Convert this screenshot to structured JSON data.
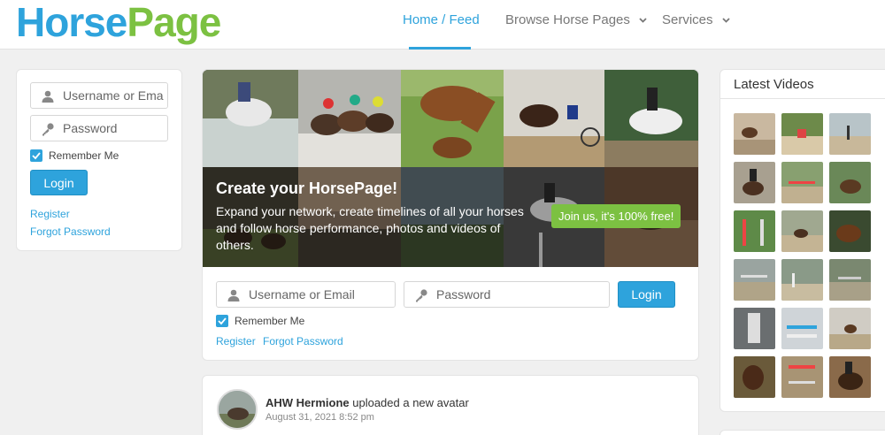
{
  "brand": {
    "part1": "Horse",
    "part2": "Page"
  },
  "nav": {
    "home": "Home / Feed",
    "browse": "Browse Horse Pages",
    "services": "Services"
  },
  "sidebar_login": {
    "username_placeholder": "Username or Email",
    "password_placeholder": "Password",
    "remember_label": "Remember Me",
    "login_label": "Login",
    "register_label": "Register",
    "forgot_label": "Forgot Password"
  },
  "hero": {
    "title": "Create your HorsePage!",
    "text": "Expand your network, create timelines of all your horses and follow horse performance, photos and videos of others.",
    "join_label": "Join us, it's 100% free!"
  },
  "main_login": {
    "username_placeholder": "Username or Email",
    "password_placeholder": "Password",
    "remember_label": "Remember Me",
    "login_label": "Login",
    "register_label": "Register",
    "forgot_label": "Forgot Password"
  },
  "post": {
    "author": "AHW Hermione",
    "action": " uploaded a new avatar",
    "date": "August 31, 2021 8:52 pm"
  },
  "videos": {
    "title": "Latest Videos"
  },
  "colors": {
    "brand_blue": "#2ea3dc",
    "brand_green": "#7cc142"
  },
  "icons": {
    "user": "user-icon",
    "key": "key-icon",
    "chevron": "chevron-down-icon",
    "check": "check-icon"
  }
}
